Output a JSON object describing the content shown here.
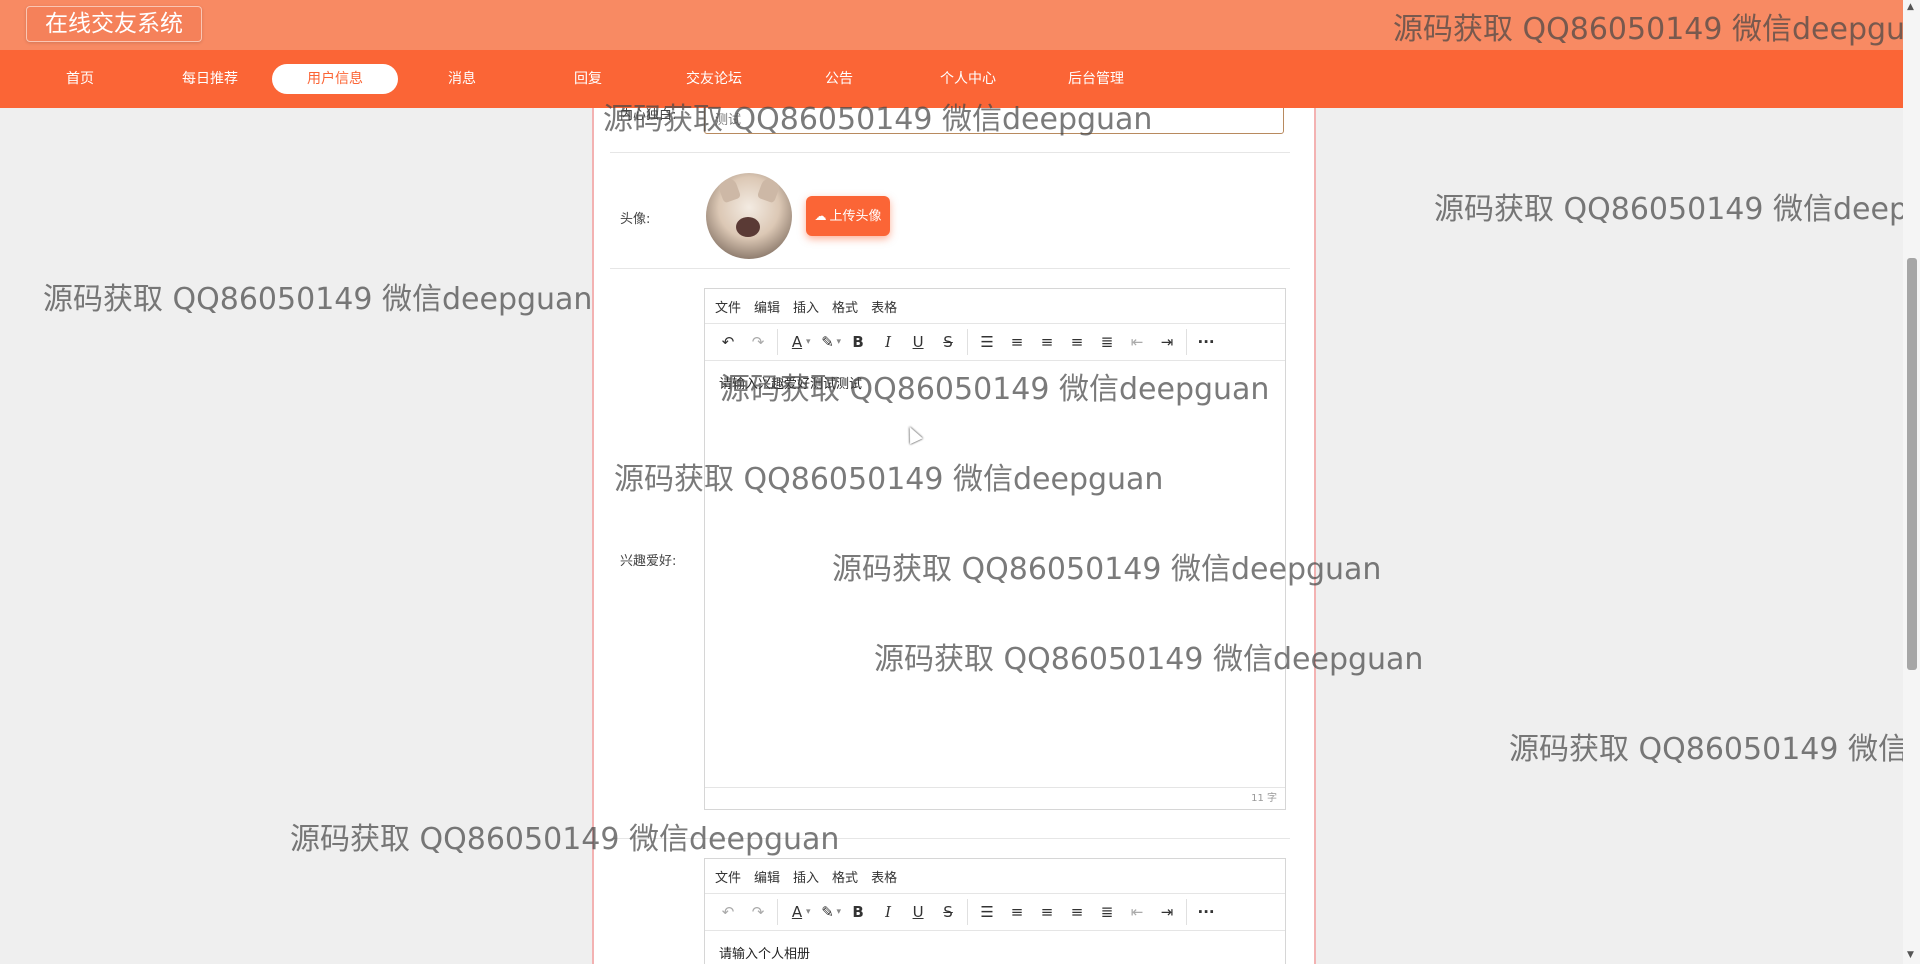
{
  "header": {
    "app_title": "在线交友系统"
  },
  "nav": {
    "items": [
      {
        "label": "首页"
      },
      {
        "label": "每日推荐"
      },
      {
        "label": "用户信息",
        "active": true
      },
      {
        "label": "消息"
      },
      {
        "label": "回复"
      },
      {
        "label": "交友论坛"
      },
      {
        "label": "公告"
      },
      {
        "label": "个人中心"
      },
      {
        "label": "后台管理"
      }
    ]
  },
  "form": {
    "monologue": {
      "label": "内心独白:",
      "value": "测试"
    },
    "avatar": {
      "label": "头像:",
      "upload_label": "上传头像"
    },
    "hobbies": {
      "label": "兴趣爱好:",
      "content": "请输入兴趣爱好测试测试",
      "word_count": "11 字"
    },
    "album": {
      "content": "请输入个人相册"
    }
  },
  "editor": {
    "menu": [
      "文件",
      "编辑",
      "插入",
      "格式",
      "表格"
    ]
  },
  "watermark": {
    "text": "源码获取 QQ86050149 微信deepguan"
  },
  "colors": {
    "accent": "#fb6536",
    "header": "#f88a63"
  }
}
